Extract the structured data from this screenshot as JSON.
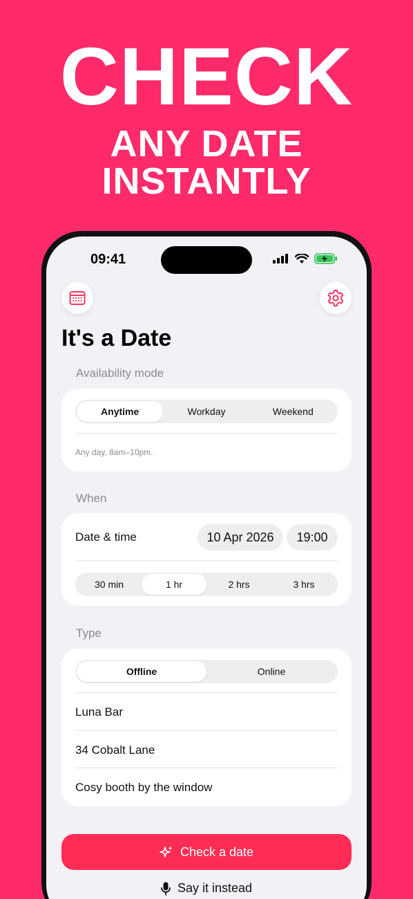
{
  "headline": {
    "line1": "CHECK",
    "line2": "ANY DATE",
    "line3": "INSTANTLY"
  },
  "status_bar": {
    "time": "09:41"
  },
  "header": {
    "left_icon": "calendar-icon",
    "right_icon": "gear-icon",
    "title": "It's a Date"
  },
  "availability": {
    "label": "Availability mode",
    "options": [
      "Anytime",
      "Workday",
      "Weekend"
    ],
    "selected": "Anytime",
    "note": "Any day, 8am–10pm."
  },
  "when": {
    "label": "When",
    "row_label": "Date & time",
    "date_value": "10 Apr 2026",
    "time_value": "19:00",
    "durations": [
      "30 min",
      "1 hr",
      "2 hrs",
      "3 hrs"
    ],
    "selected_duration": "1 hr"
  },
  "type": {
    "label": "Type",
    "options": [
      "Offline",
      "Online"
    ],
    "selected": "Offline",
    "place_name": "Luna Bar",
    "address": "34 Cobalt Lane",
    "notes": "Cosy booth by the window"
  },
  "actions": {
    "primary_label": "Check a date",
    "primary_icon": "sparkle-icon",
    "secondary_label": "Say it instead",
    "secondary_icon": "microphone-icon"
  },
  "colors": {
    "background": "#FF2A6A",
    "accent": "#FF2D55",
    "icon_accent": "#F0385F"
  }
}
